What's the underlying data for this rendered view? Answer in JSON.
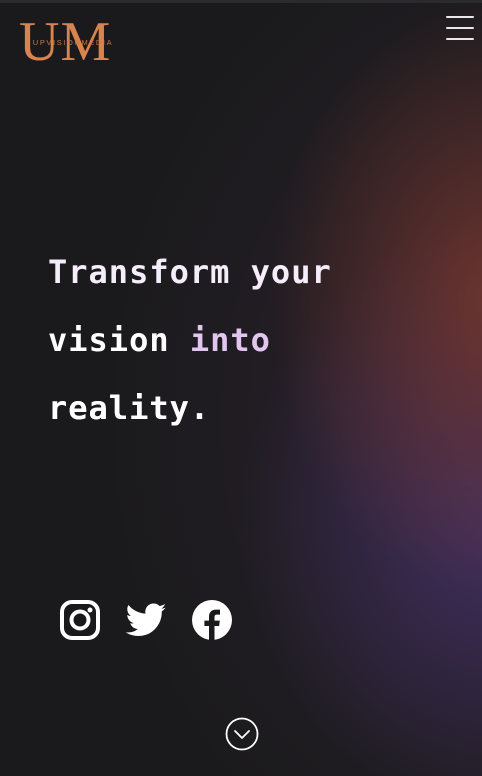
{
  "brand": {
    "logo_letters": "UM",
    "logo_subtitle": "UPVISIONMEDIA",
    "accent_color": "#d9834f"
  },
  "header": {
    "menu_icon": "hamburger-menu-icon"
  },
  "hero": {
    "headline_line1": "Transform your",
    "headline_line2_a": "vision ",
    "headline_line2_b": "into",
    "headline_line3": "reality."
  },
  "socials": [
    {
      "name": "Instagram",
      "icon": "instagram-icon"
    },
    {
      "name": "Twitter",
      "icon": "twitter-icon"
    },
    {
      "name": "Facebook",
      "icon": "facebook-icon"
    }
  ],
  "footer": {
    "scroll_icon": "chevron-down-circle-icon"
  }
}
